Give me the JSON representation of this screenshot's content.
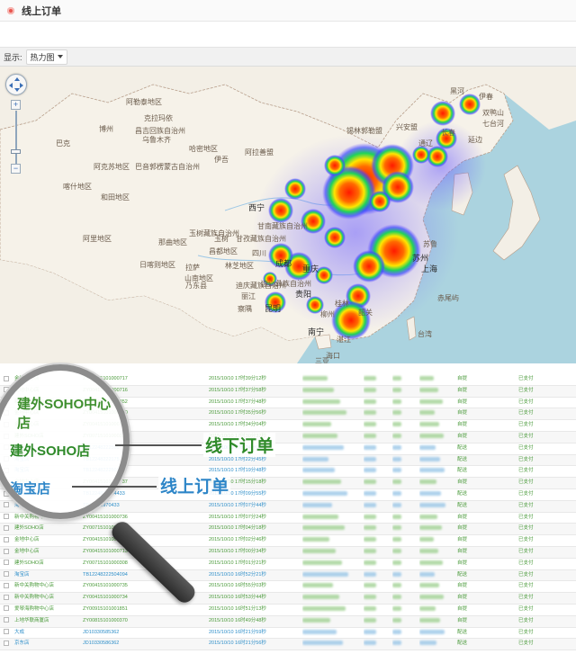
{
  "header": {
    "title": "线上订单"
  },
  "toolbar": {
    "display_label": "显示:",
    "display_value": "热力图"
  },
  "map": {
    "labels": [
      "阿勒泰地区",
      "克拉玛依",
      "博州",
      "昌吉回族自治州",
      "乌鲁木齐",
      "阿克苏地区",
      "巴音郭楞蒙古自治州",
      "哈密地区",
      "喀什地区",
      "和田地区",
      "阿里地区",
      "那曲地区",
      "日喀则地区",
      "山南地区",
      "拉萨",
      "林芝地区",
      "阿拉善盟",
      "锡林郭勒盟",
      "伊春",
      "黑河",
      "双鸭山",
      "七台河",
      "兴安盟",
      "通辽",
      "长春",
      "延边",
      "西宁",
      "甘孜藏族自治州",
      "玉树藏族自治州",
      "昌都地区",
      "迪庆藏族自治州",
      "四川",
      "成都",
      "重庆",
      "凉山彝族自治州",
      "丽江",
      "昆明",
      "南宁",
      "柳州",
      "桂林",
      "贵阳",
      "湛江",
      "海口",
      "三亚",
      "韶关",
      "苏州",
      "上海",
      "台湾",
      "苏鲁",
      "赤尾屿",
      "巴克",
      "伊吾",
      "乃东县",
      "甘南藏族自治州",
      "玉树",
      "察隅"
    ],
    "controls": {
      "zoom_in": "+",
      "zoom_out": "−"
    }
  },
  "table": {
    "rows": [
      {
        "store": "金地中心店",
        "order": "ZY00415101000717",
        "time": "2015/10/10 17时39分12秒",
        "method": "自提",
        "pay": "已支付",
        "checked": true,
        "online": false
      },
      {
        "store": "金地中心店",
        "order": "ZY00415101000716",
        "time": "2015/10/10 17时37分58秒",
        "method": "自提",
        "pay": "已支付",
        "checked": true,
        "online": false
      },
      {
        "store": "新中关购物中心店",
        "order": "ZY00415101000852",
        "time": "2015/10/10 17时37分48秒",
        "method": "自提",
        "pay": "已支付",
        "checked": true,
        "online": false
      },
      {
        "store": "金地中心店",
        "order": "ZY00415101000740",
        "time": "2015/10/10 17时35分56秒",
        "method": "自提",
        "pay": "已支付",
        "checked": true,
        "online": false
      },
      {
        "store": "金地中心店",
        "order": "ZY00415101000738",
        "time": "2015/10/10 17时34分04秒",
        "method": "自提",
        "pay": "已支付",
        "checked": true,
        "online": false
      },
      {
        "store": "建外SOHO店",
        "order": "ZY00715101000310",
        "time": "2015/10/10 17时30分32秒",
        "method": "自提",
        "pay": "已支付",
        "checked": true,
        "online": false
      },
      {
        "store": "淘宝店",
        "order": "TB12248222509",
        "time": "2015/10/10 17时24分05秒",
        "method": "配送",
        "pay": "已支付",
        "checked": false,
        "online": true
      },
      {
        "store": "淘宝店",
        "order": "TB12248222175",
        "time": "2015/10/10 17时22分45秒",
        "method": "配送",
        "pay": "已支付",
        "checked": false,
        "online": true
      },
      {
        "store": "淘宝店",
        "order": "TB12248222503",
        "time": "2015/10/10 17时19分48秒",
        "method": "配送",
        "pay": "已支付",
        "checked": false,
        "online": true
      },
      {
        "store": "金地中心店",
        "order": "ZY00415101000737",
        "time": "2015/10/10 17时15分18秒",
        "method": "自提",
        "pay": "已支付",
        "checked": true,
        "online": false
      },
      {
        "store": "淘宝店",
        "order": "TB1224822254433",
        "time": "2015/10/10 17时09分55秒",
        "method": "配送",
        "pay": "已支付",
        "checked": false,
        "online": true
      },
      {
        "store": "淘宝店",
        "order": "TB12232970433",
        "time": "2015/10/10 17时07分44秒",
        "method": "配送",
        "pay": "已支付",
        "checked": false,
        "online": true
      },
      {
        "store": "新中关购物中心店",
        "order": "ZY00415101000736",
        "time": "2015/10/10 17时07分24秒",
        "method": "自提",
        "pay": "已支付",
        "checked": true,
        "online": false
      },
      {
        "store": "建外SOHO店",
        "order": "ZY00715101000309",
        "time": "2015/10/10 17时04分18秒",
        "method": "自提",
        "pay": "已支付",
        "checked": true,
        "online": false
      },
      {
        "store": "金地中心店",
        "order": "ZY00415101000714",
        "time": "2015/10/10 17时02分46秒",
        "method": "自提",
        "pay": "已支付",
        "checked": true,
        "online": false
      },
      {
        "store": "金地中心店",
        "order": "ZY00415101000713",
        "time": "2015/10/10 17时00分34秒",
        "method": "自提",
        "pay": "已支付",
        "checked": true,
        "online": false
      },
      {
        "store": "建外SOHO店",
        "order": "ZY00715101000308",
        "time": "2015/10/10 17时01分21秒",
        "method": "自提",
        "pay": "已支付",
        "checked": true,
        "online": false
      },
      {
        "store": "淘宝店",
        "order": "TB12248222504094",
        "time": "2015/10/10 16时52分21秒",
        "method": "配送",
        "pay": "已支付",
        "checked": false,
        "online": true
      },
      {
        "store": "新中关购物中心店",
        "order": "ZY00415101000735",
        "time": "2015/10/10 16时55分03秒",
        "method": "自提",
        "pay": "已支付",
        "checked": true,
        "online": false
      },
      {
        "store": "新中关购物中心店",
        "order": "ZY00415101000734",
        "time": "2015/10/10 16时53分44秒",
        "method": "自提",
        "pay": "已支付",
        "checked": true,
        "online": false
      },
      {
        "store": "爱琴海购物中心店",
        "order": "ZY00915101001851",
        "time": "2015/10/10 16时51分13秒",
        "method": "自提",
        "pay": "已支付",
        "checked": true,
        "online": false
      },
      {
        "store": "上地华联商厦店",
        "order": "ZY00815101000370",
        "time": "2015/10/10 16时49分48秒",
        "method": "自提",
        "pay": "已支付",
        "checked": true,
        "online": false
      },
      {
        "store": "大成",
        "order": "JD10330585362",
        "time": "2015/10/10 16时21分59秒",
        "method": "配送",
        "pay": "已支付",
        "checked": true,
        "online": true
      },
      {
        "store": "京东店",
        "order": "JD10330586362",
        "time": "2015/10/10 16时21分56秒",
        "method": "配送",
        "pay": "已支付",
        "checked": true,
        "online": true
      }
    ]
  },
  "callouts": {
    "lens_top": "建外SOHO中心店",
    "offline_store": "建外SOHO店",
    "online_store": "淘宝店",
    "offline_label": "线下订单",
    "online_label": "线上订单"
  },
  "colors": {
    "offline": "#2f8a2a",
    "online": "#2e86c8",
    "heat_hot": "#ff2a00",
    "heat_mid": "#ffe600",
    "heat_cool": "#1fd35a",
    "heat_edge": "#3c4bff"
  }
}
